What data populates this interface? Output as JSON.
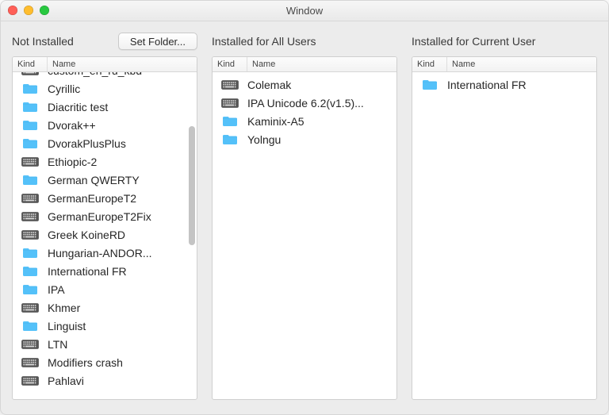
{
  "window": {
    "title": "Window"
  },
  "columns": {
    "kind": "Kind",
    "name": "Name"
  },
  "panes": {
    "not_installed": {
      "title": "Not Installed",
      "set_folder_label": "Set Folder...",
      "items": [
        {
          "kind": "keyboard",
          "name": "custom_en_ru_kbd"
        },
        {
          "kind": "folder",
          "name": "Cyrillic"
        },
        {
          "kind": "folder",
          "name": "Diacritic test"
        },
        {
          "kind": "folder",
          "name": "Dvorak++"
        },
        {
          "kind": "folder",
          "name": "DvorakPlusPlus"
        },
        {
          "kind": "keyboard",
          "name": "Ethiopic-2"
        },
        {
          "kind": "folder",
          "name": "German QWERTY"
        },
        {
          "kind": "keyboard",
          "name": "GermanEuropeT2"
        },
        {
          "kind": "keyboard",
          "name": "GermanEuropeT2Fix"
        },
        {
          "kind": "keyboard",
          "name": "Greek KoineRD"
        },
        {
          "kind": "folder",
          "name": "Hungarian-ANDOR..."
        },
        {
          "kind": "folder",
          "name": "International FR"
        },
        {
          "kind": "folder",
          "name": "IPA"
        },
        {
          "kind": "keyboard",
          "name": "Khmer"
        },
        {
          "kind": "folder",
          "name": "Linguist"
        },
        {
          "kind": "keyboard",
          "name": "LTN"
        },
        {
          "kind": "keyboard",
          "name": "Modifiers crash"
        },
        {
          "kind": "keyboard",
          "name": "Pahlavi"
        }
      ]
    },
    "all_users": {
      "title": "Installed for All Users",
      "items": [
        {
          "kind": "keyboard",
          "name": "Colemak"
        },
        {
          "kind": "keyboard",
          "name": "IPA Unicode 6.2(v1.5)..."
        },
        {
          "kind": "folder",
          "name": "Kaminix-A5"
        },
        {
          "kind": "folder",
          "name": "Yolngu"
        }
      ]
    },
    "current_user": {
      "title": "Installed for Current User",
      "items": [
        {
          "kind": "folder",
          "name": "International FR"
        }
      ]
    }
  }
}
